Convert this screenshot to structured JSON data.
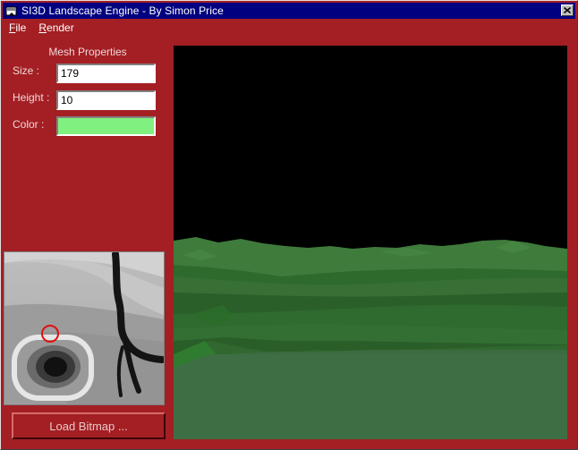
{
  "window": {
    "title": "SI3D Landscape Engine - By Simon Price",
    "background_color": "#a31f24"
  },
  "menu": [
    {
      "label": "File",
      "underline": "F",
      "rest": "ile"
    },
    {
      "label": "Render",
      "underline": "R",
      "rest": "ender"
    }
  ],
  "mesh_properties": {
    "heading": "Mesh Properties",
    "size_label": "Size :",
    "size_value": "179",
    "height_label": "Height :",
    "height_value": "10",
    "color_label": "Color :",
    "color_value": "#80f080"
  },
  "load_bitmap_label": "Load Bitmap ...",
  "icons": [
    "app-icon",
    "close-icon"
  ]
}
